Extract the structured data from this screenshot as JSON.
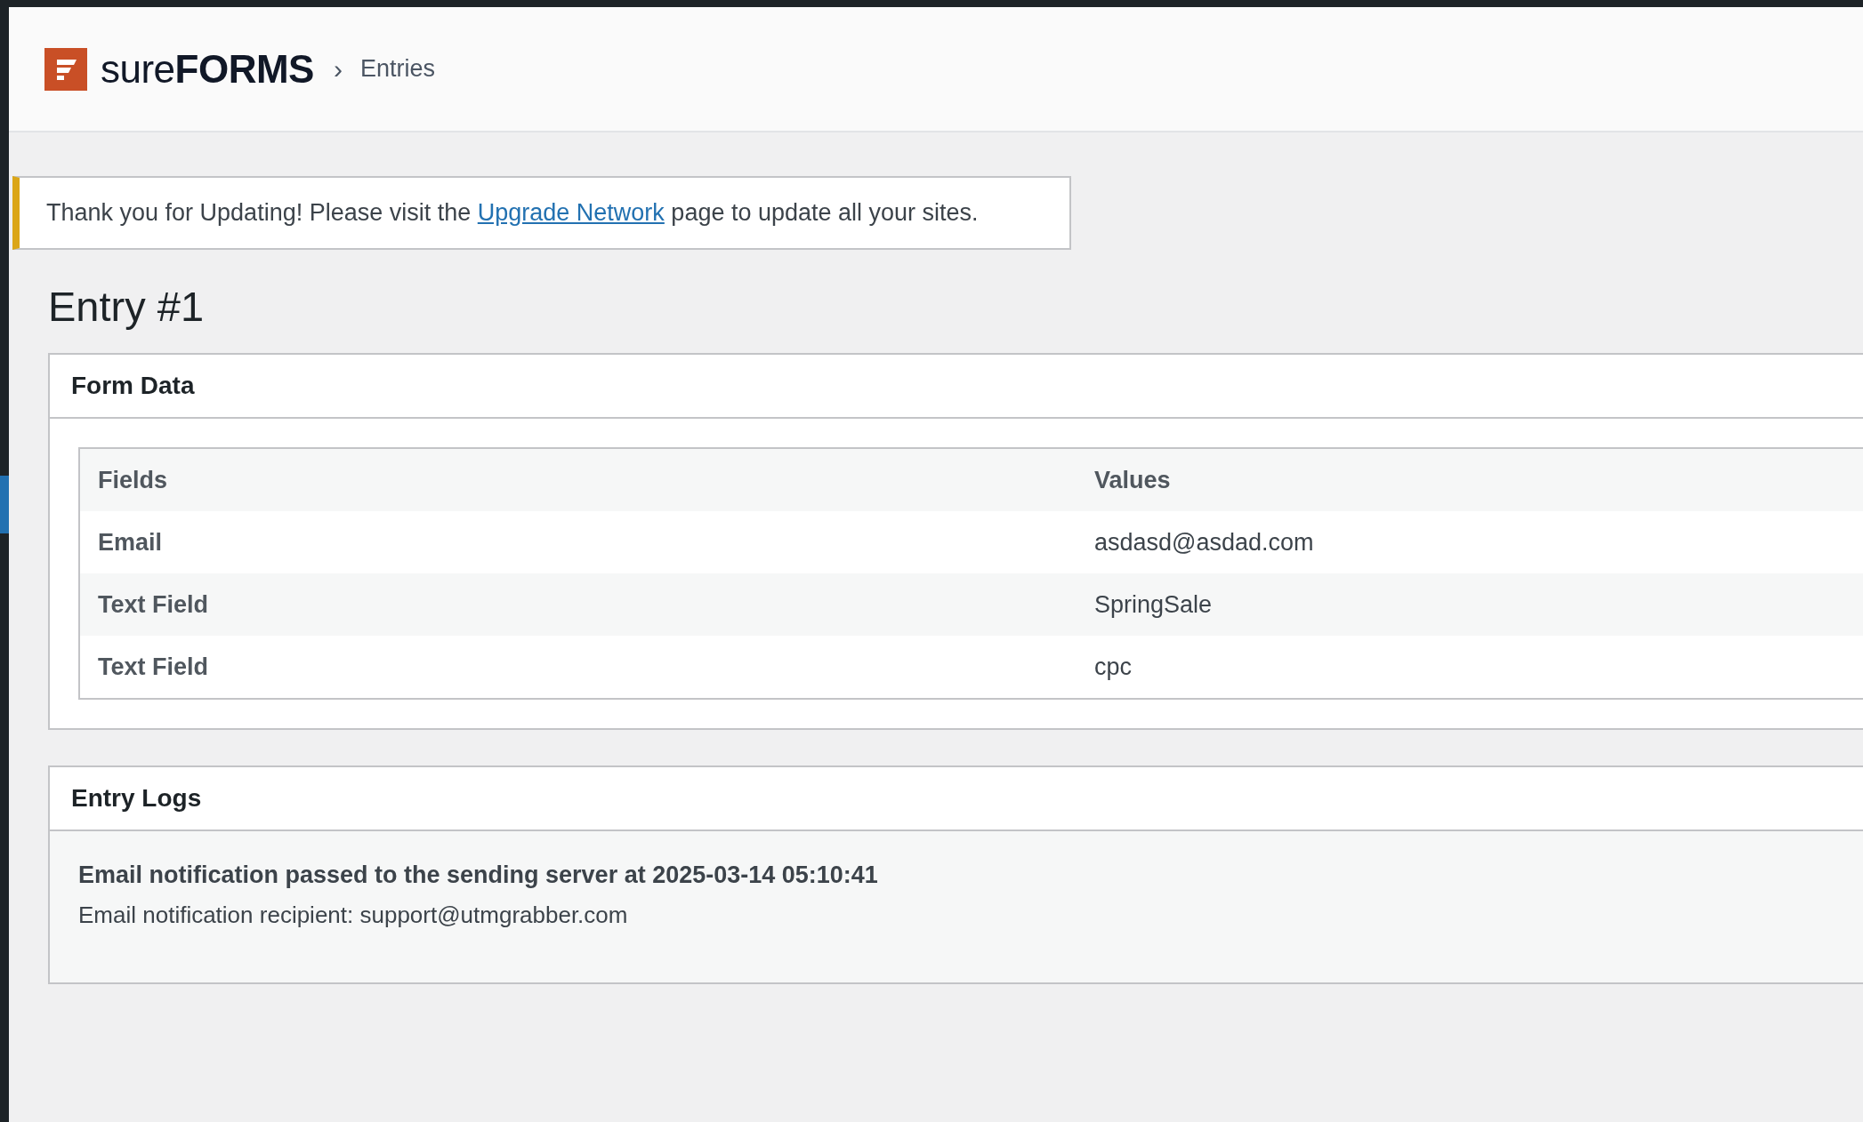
{
  "header": {
    "logo": {
      "light": "sure",
      "bold": "FORMS"
    },
    "breadcrumb_separator": "›",
    "breadcrumb": "Entries"
  },
  "notice": {
    "before": "Thank you for Updating! Please visit the",
    "link": "Upgrade Network",
    "after": "page to update all your sites."
  },
  "page_title": "Entry #1",
  "form_data": {
    "title": "Form Data",
    "columns": [
      "Fields",
      "Values"
    ],
    "rows": [
      {
        "field": "Email",
        "value": "asdasd@asdad.com"
      },
      {
        "field": "Text Field",
        "value": "SpringSale"
      },
      {
        "field": "Text Field",
        "value": "cpc"
      }
    ]
  },
  "entry_logs": {
    "title": "Entry Logs",
    "entries": [
      {
        "heading": "Email notification passed to the sending server at 2025-03-14 05:10:41",
        "detail": "Email notification recipient: support@utmgrabber.com"
      }
    ]
  }
}
